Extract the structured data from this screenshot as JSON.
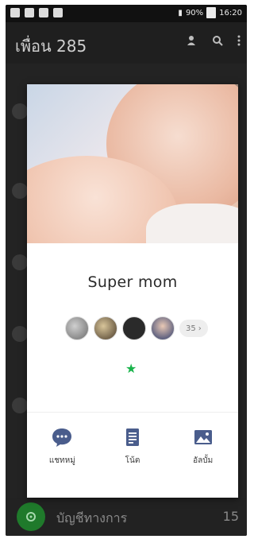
{
  "status_bar": {
    "time": "16:20",
    "signal_text": "90%"
  },
  "header": {
    "title": "เพื่อน 285"
  },
  "profile": {
    "name": "Super mom",
    "more_members": "35"
  },
  "actions": [
    {
      "label": "แชทหมู่",
      "icon": "chat-bubble-icon"
    },
    {
      "label": "โน้ต",
      "icon": "note-icon"
    },
    {
      "label": "อัลบั้ม",
      "icon": "album-icon"
    }
  ],
  "bottom_item": {
    "label": "บัญชีทางการ",
    "count": "15"
  },
  "colors": {
    "accent": "#4a5d8c",
    "star": "#18b34a",
    "dark_bg": "#1b1b1b"
  }
}
